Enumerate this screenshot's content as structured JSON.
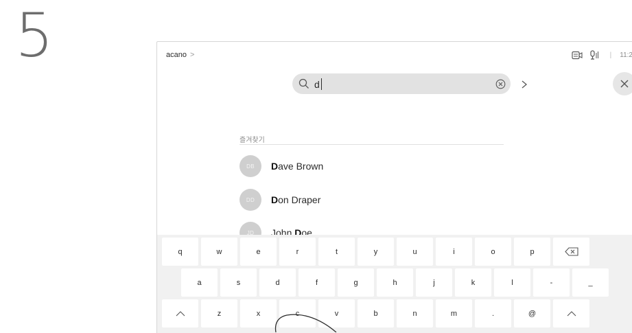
{
  "step": {
    "number": "5"
  },
  "topbar": {
    "breadcrumb": "acano",
    "breadcrumb_chevron": ">",
    "time": "11:2"
  },
  "search": {
    "value": "d",
    "placeholder": ""
  },
  "favorites": {
    "label": "즐겨찾기",
    "contacts": [
      {
        "initials": "DB",
        "highlight": "D",
        "rest": "ave Brown"
      },
      {
        "initials": "DD",
        "highlight": "D",
        "rest": "on Draper"
      },
      {
        "initials": "JD",
        "prefix": "John ",
        "highlight": "D",
        "rest": "oe"
      }
    ]
  },
  "keyboard": {
    "row1": [
      "q",
      "w",
      "e",
      "r",
      "t",
      "y",
      "u",
      "i",
      "o",
      "p"
    ],
    "row2": [
      "a",
      "s",
      "d",
      "f",
      "g",
      "h",
      "j",
      "k",
      "l",
      "-",
      "_"
    ],
    "row3": [
      "z",
      "x",
      "c",
      "v",
      "b",
      "n",
      "m",
      ".",
      "@"
    ],
    "icons": {
      "backspace": "backspace-icon",
      "shift_left": "shift-icon",
      "shift_right": "shift-icon"
    }
  },
  "colors": {
    "search_bg": "#e2e2e2",
    "avatar_bg": "#cfcfcf",
    "keyboard_bg": "#f1f1f1",
    "key_bg": "#ffffff"
  }
}
